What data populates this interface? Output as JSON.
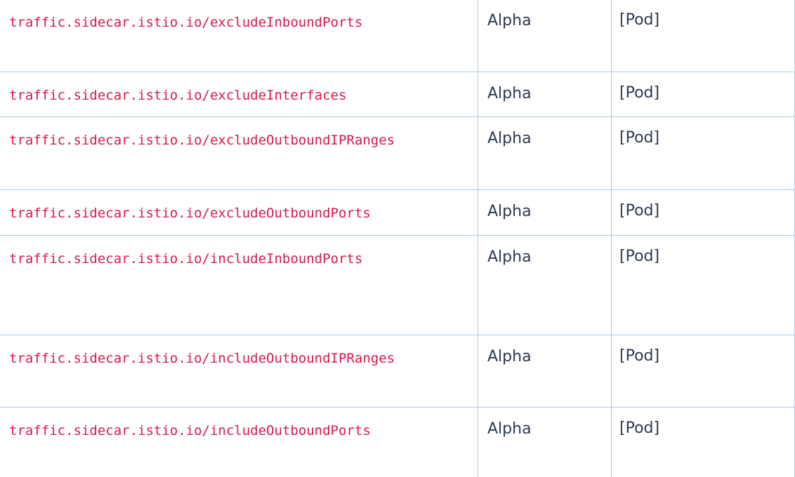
{
  "rows": [
    {
      "name": "traffic.sidecar.istio.io/excludeInboundPorts",
      "stage": "Alpha",
      "resources": "[Pod]"
    },
    {
      "name": "traffic.sidecar.istio.io/excludeInterfaces",
      "stage": "Alpha",
      "resources": "[Pod]"
    },
    {
      "name": "traffic.sidecar.istio.io/excludeOutboundIPRanges",
      "stage": "Alpha",
      "resources": "[Pod]"
    },
    {
      "name": "traffic.sidecar.istio.io/excludeOutboundPorts",
      "stage": "Alpha",
      "resources": "[Pod]"
    },
    {
      "name": "traffic.sidecar.istio.io/includeInboundPorts",
      "stage": "Alpha",
      "resources": "[Pod]"
    },
    {
      "name": "traffic.sidecar.istio.io/includeOutboundIPRanges",
      "stage": "Alpha",
      "resources": "[Pod]"
    },
    {
      "name": "traffic.sidecar.istio.io/includeOutboundPorts",
      "stage": "Alpha",
      "resources": "[Pod]"
    }
  ]
}
